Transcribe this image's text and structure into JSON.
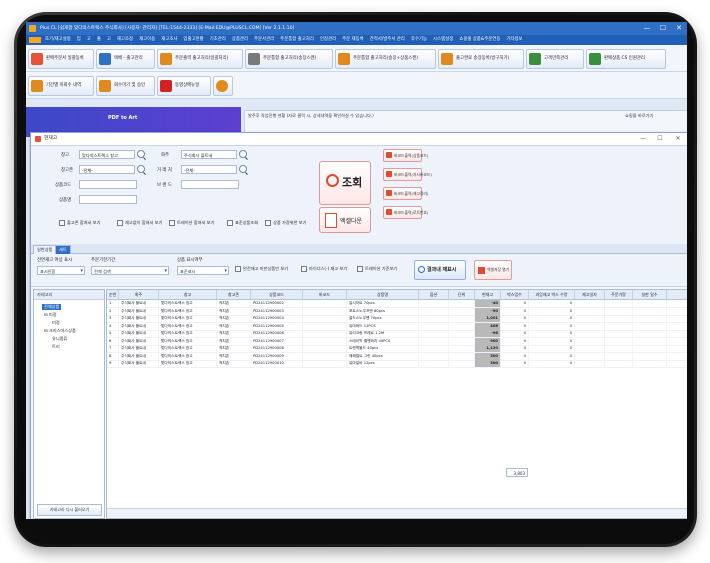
{
  "window": {
    "title": "Plus CL  [쉽게팜 맞다의스트렉스 주식회사] [사용자: 관리자] [TEL:1544-2333] [E-Mail:EDU@PLUSCL.COM] [Ver 2.1.1.10]",
    "min_glyph": "—",
    "max_glyph": "☐",
    "close_glyph": "✕"
  },
  "menu": [
    "초기/재고설정",
    "입",
    "고",
    "출",
    "고",
    "재고조정",
    "재고이동",
    "재고조사",
    "입출고현황",
    "기초관리",
    "상품관리",
    "주문서관리",
    "주문통합 출고처리",
    "인정관리",
    "주문 재등록",
    "견적서/발주서 관리",
    "후수기능",
    "시스템설정",
    "쇼핑몰 상품&주문연동",
    "기타정보"
  ],
  "toolbar1": [
    {
      "label": "판매주문서 일괄등록",
      "color": "#e8503a"
    },
    {
      "label": "택배 - 출고관리",
      "color": "#2f6fc4"
    },
    {
      "label": "주문출력 출고처리(일괄처리)",
      "color": "#e08a1e"
    },
    {
      "label": "주문통합 출고처리(송장스캔)",
      "color": "#7a7a7a"
    },
    {
      "label": "주문통합 출고처리(송장+상품스캔)",
      "color": "#e08a1e"
    },
    {
      "label": "출고완료 송장등록(방구처기)",
      "color": "#e08a1e"
    },
    {
      "label": "고객만족관리",
      "color": "#3b8e3b"
    },
    {
      "label": "판매상품 CS 인원관리",
      "color": "#3b8e3b"
    }
  ],
  "toolbar2": [
    {
      "label": "기간별 미회수 내역",
      "color": "#e08a1e"
    },
    {
      "label": "회수마기 및 승인",
      "color": "#e08a1e"
    },
    {
      "label": "동영상메뉴얼",
      "color": "#d32222"
    },
    {
      "label": "",
      "color": "#e08a1e"
    }
  ],
  "background": {
    "banner_text": "PDF to Art",
    "strip_text": "발주후 작업진행 현황 (자료 클릭 시, 상세내역을 확인하실 수 있습니다.)",
    "strip_right": "쇼핑몰 바로가기"
  },
  "stock_window": {
    "title": "현재고",
    "min_glyph": "—",
    "max_glyph": "☐",
    "close_glyph": "✕"
  },
  "search": {
    "warehouse_label": "창고",
    "warehouse_value": "맞다의스트렉스 창고",
    "client_label": "화주",
    "client_value": "주식회사 플트네",
    "location_label": "창고존",
    "location_value": "-전체-",
    "vendor_label": "거 래 처",
    "vendor_value": "-전체-",
    "code_label": "상품코드",
    "brand_label": "브 랜 드",
    "name_label": "상품명",
    "query_label": "조회",
    "excel_label": "엑셀다운",
    "print_buttons": [
      "바코드출력(상품코드)",
      "바코드출력(자사바코드)",
      "바코드출력(재고정리)",
      "바코드출력(로트번호)"
    ],
    "checks": [
      "출고존 합쳐서 보기",
      "재고없이 합쳐서 보기",
      "트레이션 합쳐서 보기",
      "표준상품조회",
      "상품 가장위한 보기"
    ]
  },
  "tabs": [
    "일반상품",
    "세트"
  ],
  "filters": {
    "period_label": "전면재고 여상 표시",
    "period_value": "표시안함",
    "order_label": "주문기한기간",
    "order_value": "전체 검색",
    "display_label": "상품 표시여부",
    "display_value": "표준표시",
    "chk_a": "안전재고 미만상품만 보기",
    "chk_b": "마이너스(-) 재고 보기",
    "chk_c": "트레이션 기준보기",
    "apply_label": "결과내 재표시",
    "save_label": "엑셀저장 열기"
  },
  "category": {
    "header": "카테고리",
    "nodes": [
      "전체상품",
      "미정",
      "미정",
      "크리스마스상품",
      "유니폼류",
      "트리"
    ],
    "button": "카테고리 다시 불러오기"
  },
  "grid": {
    "columns": [
      "순번",
      "화주",
      "창고",
      "창고존",
      "상품코드",
      "바코드",
      "상품명",
      "옵션",
      "단위",
      "현재고",
      "박스입수",
      "과잉재고 박스 수량",
      "재고일자",
      "주문가량",
      "실판 일수"
    ],
    "rows": [
      [
        "1",
        "주식회사 플트네",
        "맞다의스트렉스 창고",
        "적치존",
        "PD24112900002",
        "",
        "일시하트 70pcs",
        "",
        "",
        "-40",
        "0",
        "0",
        "",
        "",
        ""
      ],
      [
        "2",
        "주식회사 플트네",
        "맞다의스트렉스 창고",
        "적치존",
        "PD24112900003",
        "",
        "포트스노우프렌 80pcs",
        "",
        "",
        "-90",
        "0",
        "0",
        "",
        "",
        ""
      ],
      [
        "3",
        "주식회사 플트네",
        "맞다의스트렉스 창고",
        "적치존",
        "PD24112900004",
        "",
        "골드스노우펜 70pcs",
        "",
        "",
        "1,001",
        "0",
        "0",
        "",
        "",
        ""
      ],
      [
        "4",
        "주식회사 플트네",
        "맞다의스트렉스 창고",
        "적치존",
        "PD24112900005",
        "",
        "유마와드 12PCS",
        "",
        "",
        "408",
        "0",
        "0",
        "",
        "",
        ""
      ],
      [
        "5",
        "주식회사 플트네",
        "맞다의스트렉스 창고",
        "적치존",
        "PD24112900006",
        "",
        "유리크랑 프레르 1.2M",
        "",
        "",
        "-96",
        "0",
        "0",
        "",
        "",
        ""
      ],
      [
        "6",
        "주식회사 플트네",
        "맞다의스트렉스 창고",
        "적치존",
        "PD24112900007",
        "",
        "스테이픽 벨벳와치 40PCS",
        "",
        "",
        "900",
        "0",
        "0",
        "",
        "",
        ""
      ],
      [
        "7",
        "주식회사 플트네",
        "맞다의스트렉스 창고",
        "적치존",
        "PD24112900008",
        "",
        "트랜백볼드 40pcs",
        "",
        "",
        "1,120",
        "0",
        "0",
        "",
        "",
        ""
      ],
      [
        "8",
        "주식회사 플트네",
        "맞다의스트렉스 창고",
        "적치존",
        "PD24112900009",
        "",
        "매패벌트 그린 40pcs",
        "",
        "",
        "300",
        "0",
        "0",
        "",
        "",
        ""
      ],
      [
        "9",
        "주식회사 플트네",
        "맞다의스트렉스 창고",
        "적치존",
        "PD24112900010",
        "",
        "유마일비 12pcs",
        "",
        "",
        "300",
        "0",
        "0",
        "",
        "",
        ""
      ]
    ],
    "total": "3,803"
  }
}
